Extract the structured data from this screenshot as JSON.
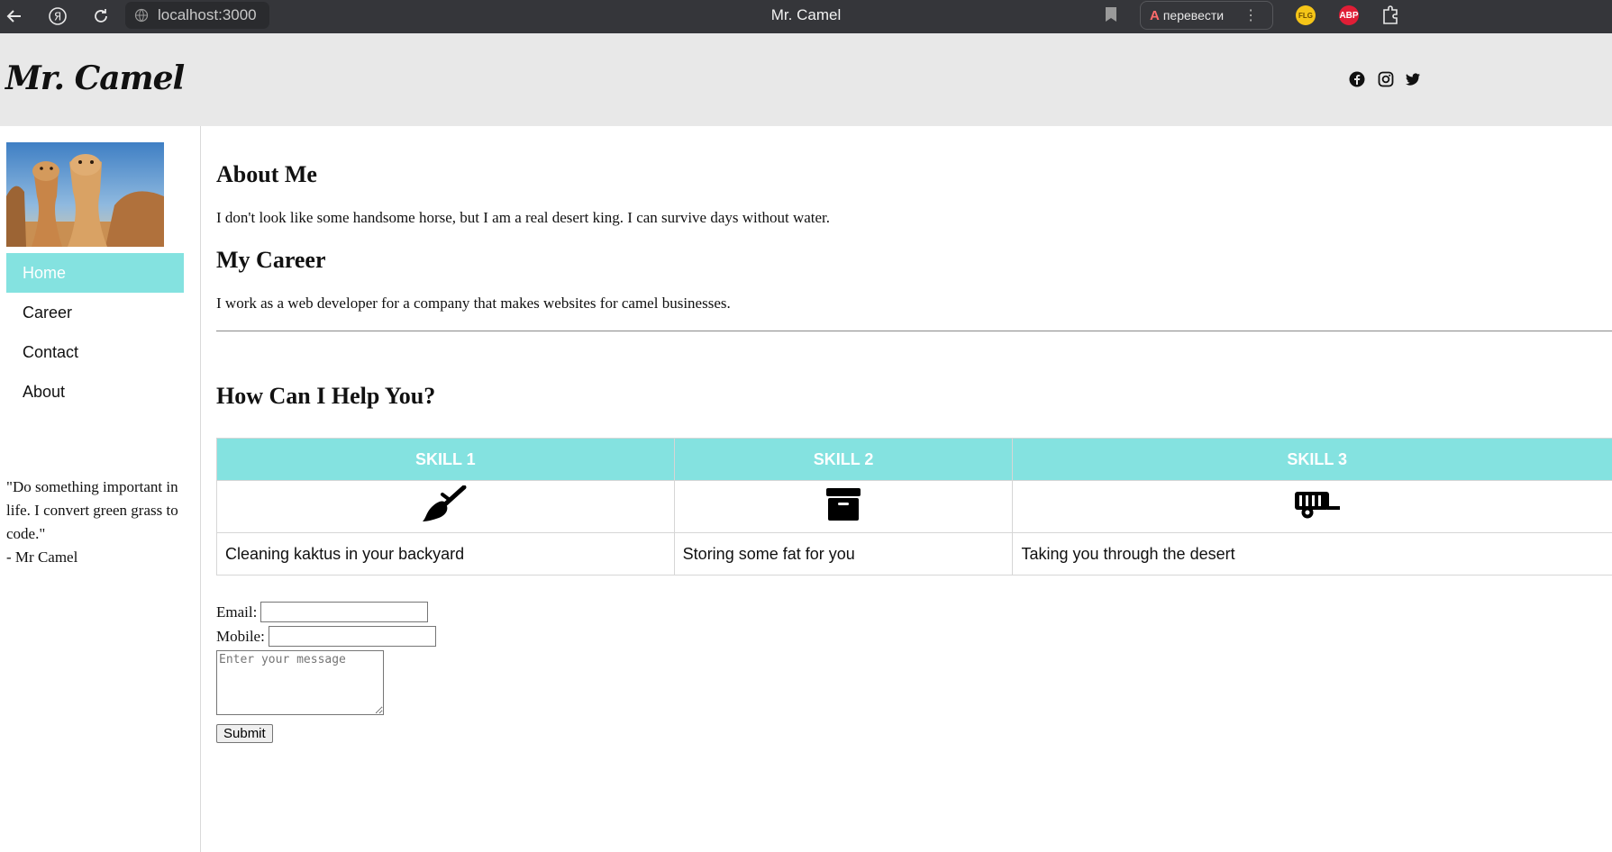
{
  "browser": {
    "url": "localhost:3000",
    "tab_title": "Mr. Camel",
    "translate_label": "перевести",
    "translate_glyph": "A",
    "extensions": [
      "FLG",
      "ABP"
    ]
  },
  "site": {
    "logo": "Mr. Camel",
    "social_icons": [
      "facebook-icon",
      "instagram-icon",
      "twitter-icon"
    ]
  },
  "sidebar": {
    "nav": [
      {
        "label": "Home",
        "active": true
      },
      {
        "label": "Career",
        "active": false
      },
      {
        "label": "Contact",
        "active": false
      },
      {
        "label": "About",
        "active": false
      }
    ],
    "quote_line": "\"Do something important in life. I convert green grass to code.\"",
    "quote_author": "- Mr Camel"
  },
  "main": {
    "about_title": "About Me",
    "about_text": "I don't look like some handsome horse, but I am a real desert king. I can survive days without water.",
    "career_title": "My Career",
    "career_text": "I work as a web developer for a company that makes websites for camel businesses.",
    "help_title": "How Can I Help You?",
    "skills": [
      {
        "header": "SKILL 1",
        "icon": "broom-icon",
        "description": "Cleaning kaktus in your backyard"
      },
      {
        "header": "SKILL 2",
        "icon": "archive-box-icon",
        "description": "Storing some fat for you"
      },
      {
        "header": "SKILL 3",
        "icon": "trailer-icon",
        "description": "Taking you through the desert"
      }
    ]
  },
  "form": {
    "email_label": "Email:",
    "mobile_label": "Mobile:",
    "email_value": "",
    "mobile_value": "",
    "message_placeholder": "Enter your message",
    "submit_label": "Submit"
  },
  "colors": {
    "accent": "#84e2e0",
    "header_bg": "#e8e8e8",
    "chrome_bg": "#35363a"
  }
}
